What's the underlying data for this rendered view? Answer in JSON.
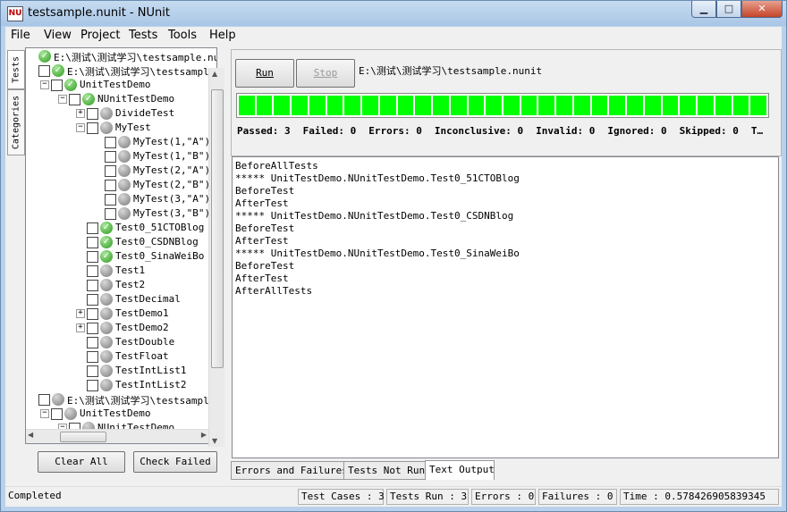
{
  "window": {
    "title": "testsample.nunit - NUnit",
    "icon_text": "NU"
  },
  "menu": [
    "File",
    "View",
    "Project",
    "Tests",
    "Tools",
    "Help"
  ],
  "side_tabs": [
    "Tests",
    "Categories"
  ],
  "tree": [
    {
      "label": "E:\\测试\\测试学习\\testsample.nunit",
      "status": "pass",
      "exp": "",
      "check": false
    },
    {
      "label": "E:\\测试\\测试学习\\testsample",
      "status": "pass",
      "exp": "",
      "check": true
    },
    {
      "label": "UnitTestDemo",
      "status": "pass",
      "exp": "−",
      "check": true
    },
    {
      "label": "NUnitTestDemo",
      "status": "pass",
      "exp": "−",
      "check": true
    },
    {
      "label": "DivideTest",
      "status": "gray",
      "exp": "+",
      "check": true
    },
    {
      "label": "MyTest",
      "status": "gray",
      "exp": "−",
      "check": true
    },
    {
      "label": "MyTest(1,\"A\")",
      "status": "gray",
      "exp": "",
      "check": true
    },
    {
      "label": "MyTest(1,\"B\")",
      "status": "gray",
      "exp": "",
      "check": true
    },
    {
      "label": "MyTest(2,\"A\")",
      "status": "gray",
      "exp": "",
      "check": true
    },
    {
      "label": "MyTest(2,\"B\")",
      "status": "gray",
      "exp": "",
      "check": true
    },
    {
      "label": "MyTest(3,\"A\")",
      "status": "gray",
      "exp": "",
      "check": true
    },
    {
      "label": "MyTest(3,\"B\")",
      "status": "gray",
      "exp": "",
      "check": true
    },
    {
      "label": "Test0_51CTOBlog",
      "status": "pass",
      "exp": "",
      "check": true
    },
    {
      "label": "Test0_CSDNBlog",
      "status": "pass",
      "exp": "",
      "check": true
    },
    {
      "label": "Test0_SinaWeiBo",
      "status": "pass",
      "exp": "",
      "check": true
    },
    {
      "label": "Test1",
      "status": "gray",
      "exp": "",
      "check": true
    },
    {
      "label": "Test2",
      "status": "gray",
      "exp": "",
      "check": true
    },
    {
      "label": "TestDecimal",
      "status": "gray",
      "exp": "",
      "check": true
    },
    {
      "label": "TestDemo1",
      "status": "gray",
      "exp": "+",
      "check": true
    },
    {
      "label": "TestDemo2",
      "status": "gray",
      "exp": "+",
      "check": true
    },
    {
      "label": "TestDouble",
      "status": "gray",
      "exp": "",
      "check": true
    },
    {
      "label": "TestFloat",
      "status": "gray",
      "exp": "",
      "check": true
    },
    {
      "label": "TestIntList1",
      "status": "gray",
      "exp": "",
      "check": true
    },
    {
      "label": "TestIntList2",
      "status": "gray",
      "exp": "",
      "check": true
    },
    {
      "label": "E:\\测试\\测试学习\\testsampl",
      "status": "gray",
      "exp": "",
      "check": true
    },
    {
      "label": "UnitTestDemo",
      "status": "gray",
      "exp": "−",
      "check": true
    },
    {
      "label": "NUnitTestDemo",
      "status": "gray",
      "exp": "−",
      "check": true
    }
  ],
  "buttons": {
    "clear_all": "Clear All",
    "check_failed": "Check Failed",
    "run": "Run",
    "stop": "Stop"
  },
  "top": {
    "path": "E:\\测试\\测试学习\\testsample.nunit",
    "progress": 1.0,
    "progress_color": "#00ff00",
    "summary": [
      "Passed: 3",
      "Failed: 0",
      "Errors: 0",
      "Inconclusive: 0",
      "Invalid: 0",
      "Ignored: 0",
      "Skipped: 0",
      "T…"
    ]
  },
  "output_lines": [
    "BeforeAllTests",
    "***** UnitTestDemo.NUnitTestDemo.Test0_51CTOBlog",
    "BeforeTest",
    "AfterTest",
    "***** UnitTestDemo.NUnitTestDemo.Test0_CSDNBlog",
    "BeforeTest",
    "AfterTest",
    "***** UnitTestDemo.NUnitTestDemo.Test0_SinaWeiBo",
    "BeforeTest",
    "AfterTest",
    "AfterAllTests"
  ],
  "bottom_tabs": [
    "Errors and Failures",
    "Tests Not Run",
    "Text Output"
  ],
  "status": {
    "text": "Completed",
    "test_cases": "Test Cases : 3",
    "tests_run": "Tests Run : 3",
    "errors": "Errors : 0",
    "failures": "Failures : 0",
    "time": "Time : 0.578426905839345"
  }
}
